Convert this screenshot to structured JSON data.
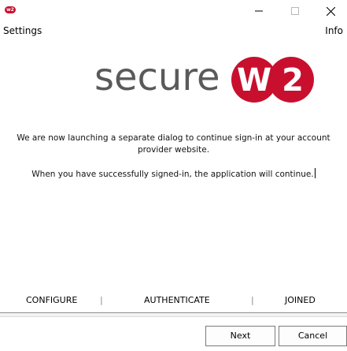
{
  "window": {
    "app_icon_text": "w2",
    "controls": {
      "minimize_icon": "minimize-icon",
      "maximize_icon": "maximize-icon",
      "close_icon": "close-icon"
    }
  },
  "menu": {
    "settings_label": "Settings",
    "info_label": "Info"
  },
  "logo": {
    "text": "secure",
    "badge_w": "W",
    "badge_2": "2",
    "text_color": "#5a5a5a",
    "badge_color": "#c8102e"
  },
  "message": {
    "line1": "We are now launching a separate dialog to continue sign-in at your account provider website.",
    "line2": "When you have successfully signed-in, the application will continue."
  },
  "steps": {
    "configure": "CONFIGURE",
    "separator": "|",
    "authenticate": "AUTHENTICATE",
    "joined": "JOINED"
  },
  "buttons": {
    "next": "Next",
    "cancel": "Cancel"
  }
}
